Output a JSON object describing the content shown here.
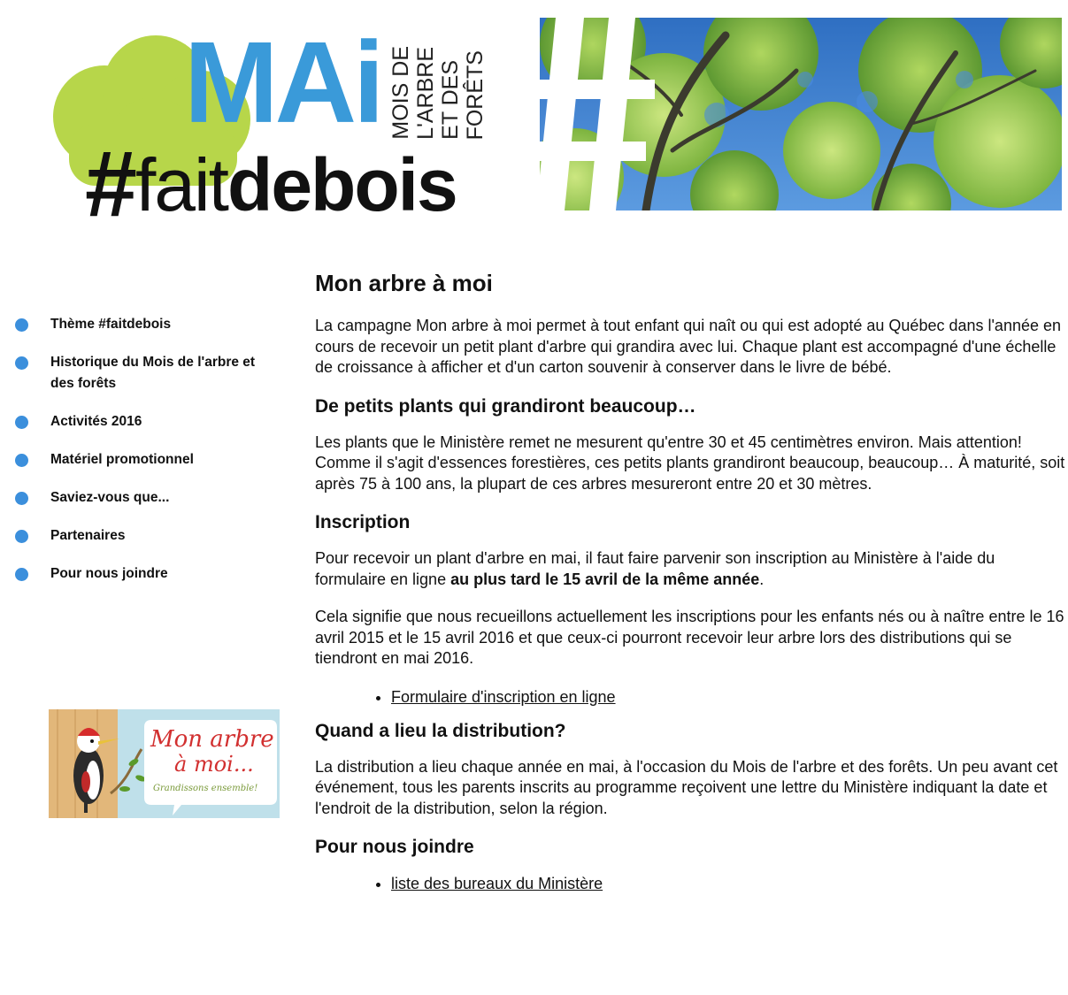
{
  "banner": {
    "logo_mai": "MAi",
    "logo_vertical_lines": [
      "MOIS DE",
      "L'ARBRE",
      "ET DES",
      "FORÊTS"
    ],
    "logo_hash": "#",
    "logo_fait": "fait",
    "logo_debois": "debois",
    "colors": {
      "cloud": "#b7d64a",
      "mai_blue": "#3a9ad9",
      "dark": "#111111"
    },
    "photo_icon": "tree-canopy-photo"
  },
  "sidebar": {
    "bullet_color": "#3b8fdc",
    "items": [
      {
        "label": "Thème #faitdebois"
      },
      {
        "label": "Historique du Mois de l'arbre et des forêts"
      },
      {
        "label": "Activités 2016"
      },
      {
        "label": "Matériel promotionnel"
      },
      {
        "label": "Saviez-vous que..."
      },
      {
        "label": "Partenaires"
      },
      {
        "label": "Pour nous joindre"
      }
    ],
    "promo": {
      "title_line1": "Mon arbre",
      "title_line2": "à moi...",
      "tagline": "Grandissons ensemble!"
    }
  },
  "main": {
    "title": "Mon arbre à moi",
    "intro": "La campagne Mon arbre à moi permet à tout enfant qui naît ou qui est adopté au Québec dans l'année en cours de recevoir un petit plant d'arbre qui grandira avec lui. Chaque plant est accompagné d'une échelle de croissance à afficher et d'un carton souvenir à conserver dans le livre de bébé.",
    "section1": {
      "heading": "De petits plants qui grandiront beaucoup…",
      "text": "Les plants que le Ministère remet ne mesurent qu'entre 30 et 45 centimètres environ. Mais attention! Comme il s'agit d'essences forestières, ces petits plants grandiront beaucoup, beaucoup… À maturité, soit après 75 à 100 ans, la plupart de ces arbres mesureront entre 20 et 30 mètres."
    },
    "section2": {
      "heading": "Inscription",
      "text_part1": "Pour recevoir un plant d'arbre en mai, il faut faire parvenir son inscription au Ministère à l'aide du formulaire en ligne ",
      "text_bold": "au plus tard le 15 avril de la même année",
      "text_part2": ".",
      "text2": "Cela signifie que nous recueillons actuellement les inscriptions pour les enfants nés ou à naître entre le 16 avril 2015 et le 15 avril 2016 et que ceux-ci pourront recevoir leur arbre lors des distributions qui se tiendront en mai 2016.",
      "link": "Formulaire d'inscription en ligne"
    },
    "section3": {
      "heading": "Quand a lieu la distribution?",
      "text": "La distribution a lieu chaque année en mai, à l'occasion du Mois de l'arbre et des forêts. Un peu avant cet événement, tous les parents inscrits au programme reçoivent une lettre du Ministère indiquant la date et l'endroit de la distribution, selon la région."
    },
    "section4": {
      "heading": "Pour nous joindre",
      "link": "liste des bureaux du Ministère"
    }
  }
}
